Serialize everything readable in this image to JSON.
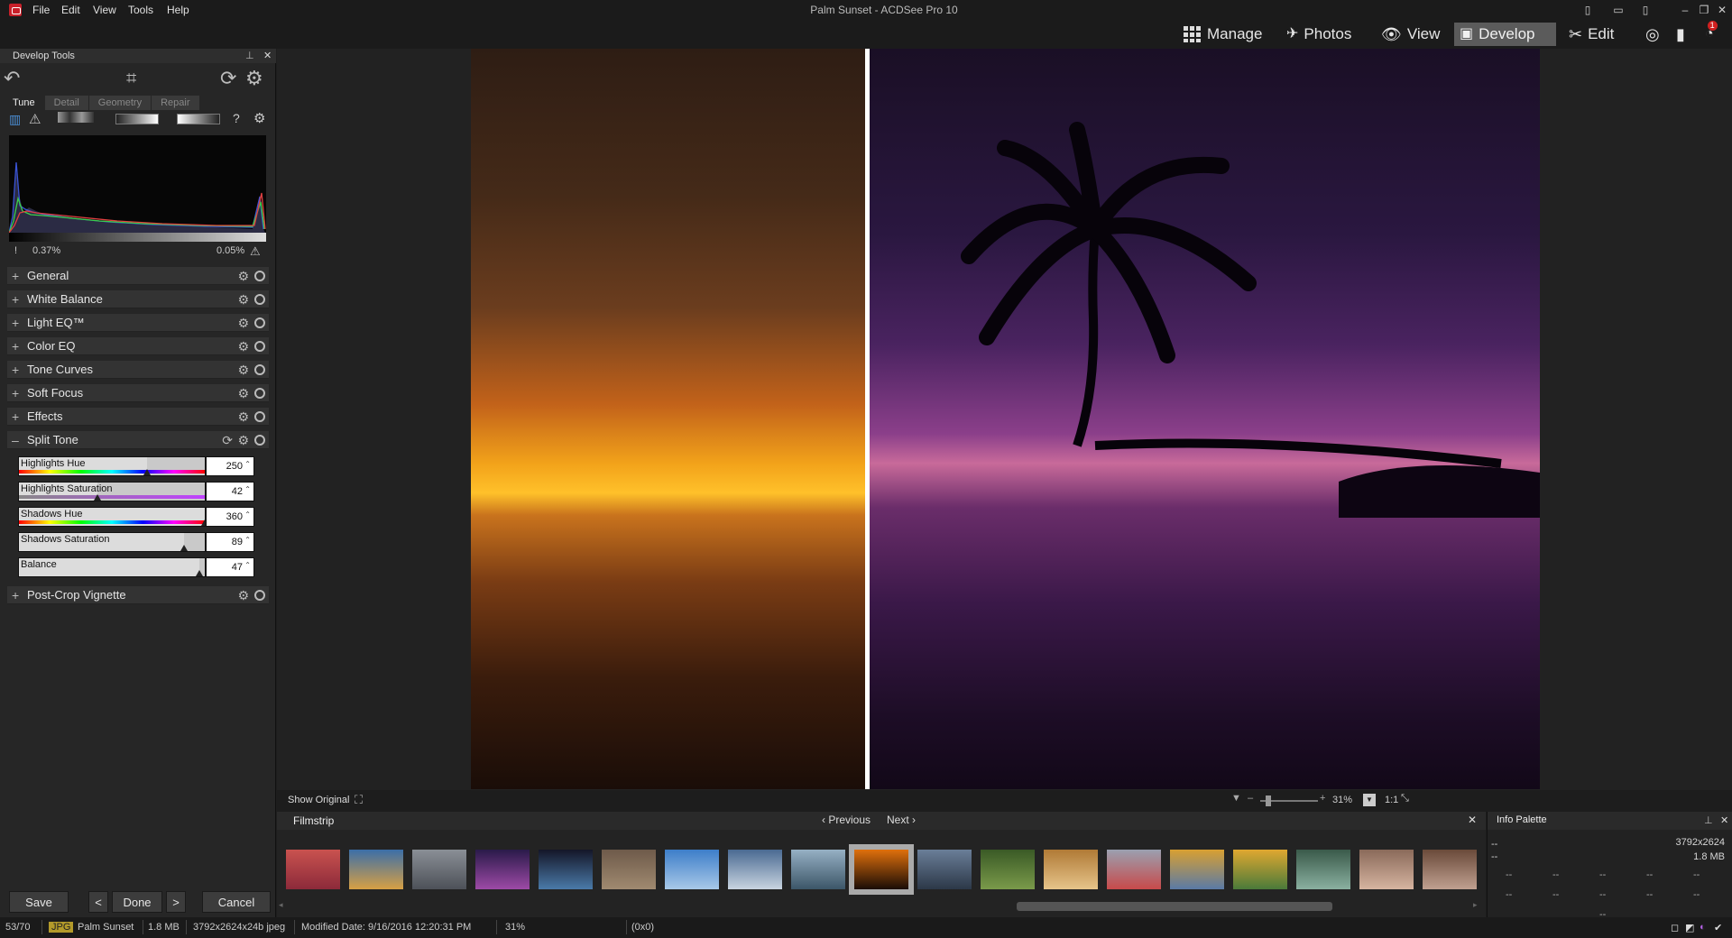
{
  "window": {
    "title": "Palm Sunset - ACDSee Pro 10",
    "menu": [
      "File",
      "Edit",
      "View",
      "Tools",
      "Help"
    ]
  },
  "modes": {
    "manage": "Manage",
    "photos": "Photos",
    "view": "View",
    "develop": "Develop",
    "edit": "Edit",
    "notification_count": "1"
  },
  "left_panel": {
    "title": "Develop Tools",
    "tabs": [
      "Tune",
      "Detail",
      "Geometry",
      "Repair"
    ],
    "histogram": {
      "shadow_clip": "0.37%",
      "highlight_clip": "0.05%"
    },
    "sections": {
      "general": "General",
      "white_balance": "White Balance",
      "light_eq": "Light EQ™",
      "color_eq": "Color EQ",
      "tone_curves": "Tone Curves",
      "soft_focus": "Soft Focus",
      "effects": "Effects",
      "split_tone": "Split Tone",
      "post_crop_vignette": "Post-Crop Vignette"
    },
    "split_tone": {
      "highlights_hue": {
        "label": "Highlights Hue",
        "value": "250",
        "fraction": 0.69
      },
      "highlights_saturation": {
        "label": "Highlights Saturation",
        "value": "42",
        "fraction": 0.42
      },
      "shadows_hue": {
        "label": "Shadows Hue",
        "value": "360",
        "fraction": 1.0
      },
      "shadows_saturation": {
        "label": "Shadows Saturation",
        "value": "89",
        "fraction": 0.89
      },
      "balance": {
        "label": "Balance",
        "value": "47",
        "fraction": 0.97
      }
    },
    "buttons": {
      "save": "Save",
      "done": "Done",
      "cancel": "Cancel"
    }
  },
  "canvas": {
    "show_original": "Show Original",
    "zoom": "31%",
    "one_to_one": "1:1"
  },
  "filmstrip": {
    "title": "Filmstrip",
    "previous": "Previous",
    "next": "Next",
    "thumb_colors": [
      [
        "#c9524f",
        "#8c2a3a"
      ],
      [
        "#3b6ea8",
        "#d7a044"
      ],
      [
        "#8a8f96",
        "#4d5158"
      ],
      [
        "#2a1a4a",
        "#9d4aa6"
      ],
      [
        "#141628",
        "#4a7aa8"
      ],
      [
        "#6e5a4a",
        "#a08a70"
      ],
      [
        "#3d7ec9",
        "#a8c8e8"
      ],
      [
        "#4a6a92",
        "#c8d4e0"
      ],
      [
        "#96b0c4",
        "#3c5668"
      ],
      [
        "#e0700c",
        "#1a0c06"
      ],
      [
        "#6a7e98",
        "#2c3848"
      ],
      [
        "#3a5a26",
        "#7a9a4a"
      ],
      [
        "#b07a36",
        "#e6c48a"
      ],
      [
        "#9aa0b0",
        "#c84a4a"
      ],
      [
        "#d8a032",
        "#5a7aa6"
      ],
      [
        "#e0a830",
        "#4a7a3a"
      ],
      [
        "#3a5a4a",
        "#8ab0a0"
      ],
      [
        "#8a6a5a",
        "#d6b4a0"
      ],
      [
        "#6a4a3a",
        "#c0a090"
      ]
    ]
  },
  "info_palette": {
    "title": "Info Palette",
    "dimensions": "3792x2624",
    "size": "1.8 MB",
    "placeholder": "--"
  },
  "statusbar": {
    "index": "53/70",
    "format": "JPG",
    "filename": "Palm Sunset",
    "filesize": "1.8 MB",
    "image_info": "3792x2624x24b jpeg",
    "modified": "Modified Date: 9/16/2016 12:20:31 PM",
    "zoom": "31%",
    "coords": "(0x0)"
  }
}
